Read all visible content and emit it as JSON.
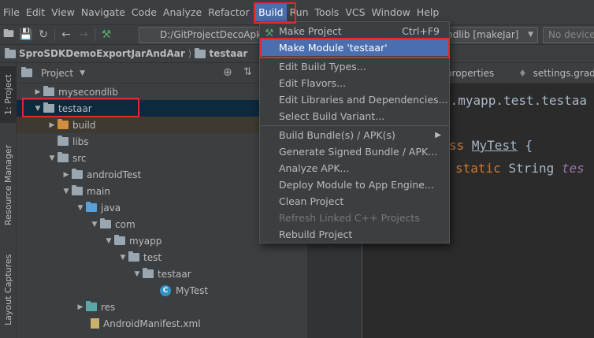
{
  "menubar": {
    "items": [
      "File",
      "Edit",
      "View",
      "Navigate",
      "Code",
      "Analyze",
      "Refactor",
      "Build",
      "Run",
      "Tools",
      "VCS",
      "Window",
      "Help"
    ],
    "active": "Build"
  },
  "toolbar": {
    "path": "D:/GitProjectDecoApk",
    "run_config": "ndlib [makeJar]",
    "device_placeholder": "No device"
  },
  "navbar": {
    "project": "SproSDKDemoExportJarAndAar",
    "module": "testaar"
  },
  "left_stripe": {
    "project_label": "1: Project",
    "resource_manager_label": "Resource Manager",
    "layout_captures_label": "Layout Captures"
  },
  "project_panel": {
    "title": "Project",
    "tree": [
      {
        "label": "mysecondlib",
        "icon": "module-folder-icon"
      },
      {
        "label": "testaar",
        "icon": "module-folder-icon"
      },
      {
        "label": "build",
        "icon": "folder-icon"
      },
      {
        "label": "libs",
        "icon": "folder-icon"
      },
      {
        "label": "src",
        "icon": "folder-icon"
      },
      {
        "label": "androidTest",
        "icon": "folder-icon"
      },
      {
        "label": "main",
        "icon": "folder-icon"
      },
      {
        "label": "java",
        "icon": "source-folder-icon"
      },
      {
        "label": "com",
        "icon": "package-icon"
      },
      {
        "label": "myapp",
        "icon": "package-icon"
      },
      {
        "label": "test",
        "icon": "package-icon"
      },
      {
        "label": "testaar",
        "icon": "package-icon"
      },
      {
        "label": "MyTest",
        "icon": "class-icon"
      },
      {
        "label": "res",
        "icon": "resource-folder-icon"
      },
      {
        "label": "AndroidManifest.xml",
        "icon": "manifest-icon"
      }
    ]
  },
  "editor": {
    "tabs": [
      "properties",
      "settings.grad"
    ],
    "code": {
      "package_line": "m.myapp.test.testaa",
      "class_keyword": "ss",
      "class_name": "MyTest",
      "class_brace": "{",
      "field_keyword": "static",
      "field_type": "String",
      "field_name": "tes"
    }
  },
  "build_menu": {
    "items": [
      {
        "label": "Make Project",
        "shortcut": "Ctrl+F9"
      },
      {
        "label": "Make Module 'testaar'"
      },
      {
        "label": "Edit Build Types..."
      },
      {
        "label": "Edit Flavors..."
      },
      {
        "label": "Edit Libraries and Dependencies..."
      },
      {
        "label": "Select Build Variant..."
      },
      {
        "label": "Build Bundle(s) / APK(s)"
      },
      {
        "label": "Generate Signed Bundle / APK..."
      },
      {
        "label": "Analyze APK..."
      },
      {
        "label": "Deploy Module to App Engine..."
      },
      {
        "label": "Clean Project"
      },
      {
        "label": "Refresh Linked C++ Projects"
      },
      {
        "label": "Rebuild Project"
      }
    ]
  },
  "colors": {
    "selection": "#4b6eaf",
    "annotation_red": "#e5262b",
    "keyword": "#cc7832",
    "background": "#2b2b2b"
  }
}
